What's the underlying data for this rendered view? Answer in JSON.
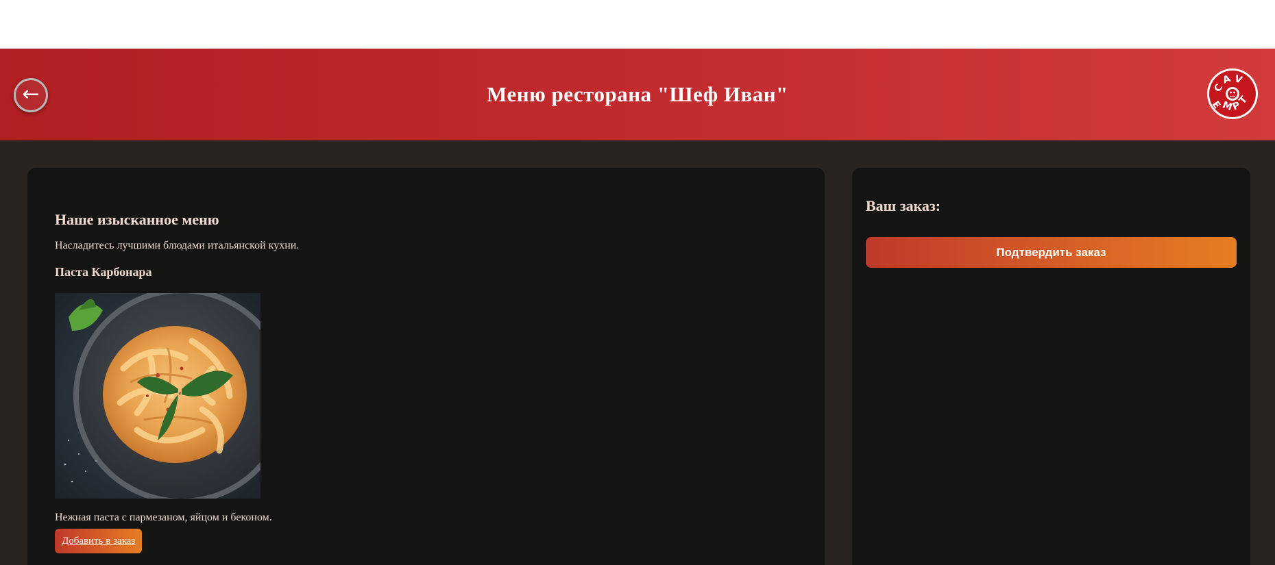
{
  "header": {
    "back_symbol": "←",
    "title": "Меню ресторана \"Шеф Иван\"",
    "logo_text": "CAVEMPT",
    "logo_icon": "logo-badge"
  },
  "menu": {
    "heading": "Наше изысканное меню",
    "subtitle": "Насладитесь лучшими блюдами итальянской кухни.",
    "items": [
      {
        "name": "Паста Карбонара",
        "image": "pasta-photo",
        "description": "Нежная паста с пармезаном, яйцом и беконом.",
        "add_label": "Добавить в заказ"
      }
    ]
  },
  "order": {
    "heading": "Ваш заказ:",
    "confirm_label": "Подтвердить заказ"
  },
  "colors": {
    "header_start": "#b11f22",
    "header_end": "#d23a3b",
    "background": "#29241f",
    "panel": "#141413",
    "accent_start": "#c0392b",
    "accent_end": "#e67e22",
    "heading_text": "#f1d9d0"
  }
}
